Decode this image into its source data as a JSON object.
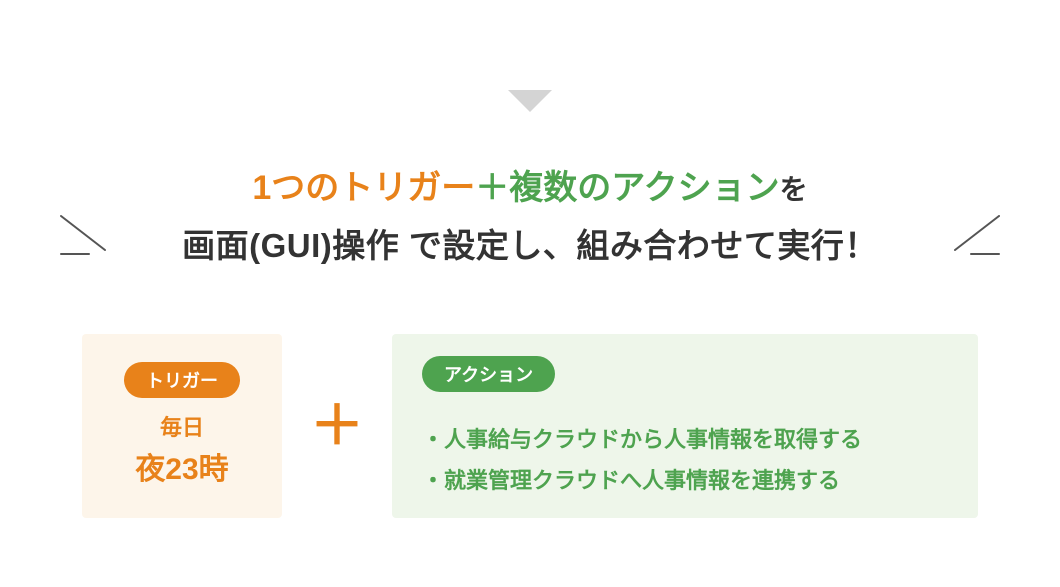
{
  "headline": {
    "trigger_phrase": "1つのトリガー",
    "plus": "＋",
    "action_phrase": "複数のアクション",
    "suffix": "を",
    "line2": "画面(GUI)操作 で設定し、組み合わせて実行！"
  },
  "trigger": {
    "pill": "トリガー",
    "line1": "毎日",
    "line2": "夜23時"
  },
  "plus_symbol": "＋",
  "action": {
    "pill": "アクション",
    "items": [
      "人事給与クラウドから人事情報を取得する",
      "就業管理クラウドへ人事情報を連携する"
    ]
  },
  "colors": {
    "orange": "#e8821a",
    "green": "#4ea34f",
    "trigger_bg": "#fdf5ea",
    "action_bg": "#eef6ea"
  }
}
